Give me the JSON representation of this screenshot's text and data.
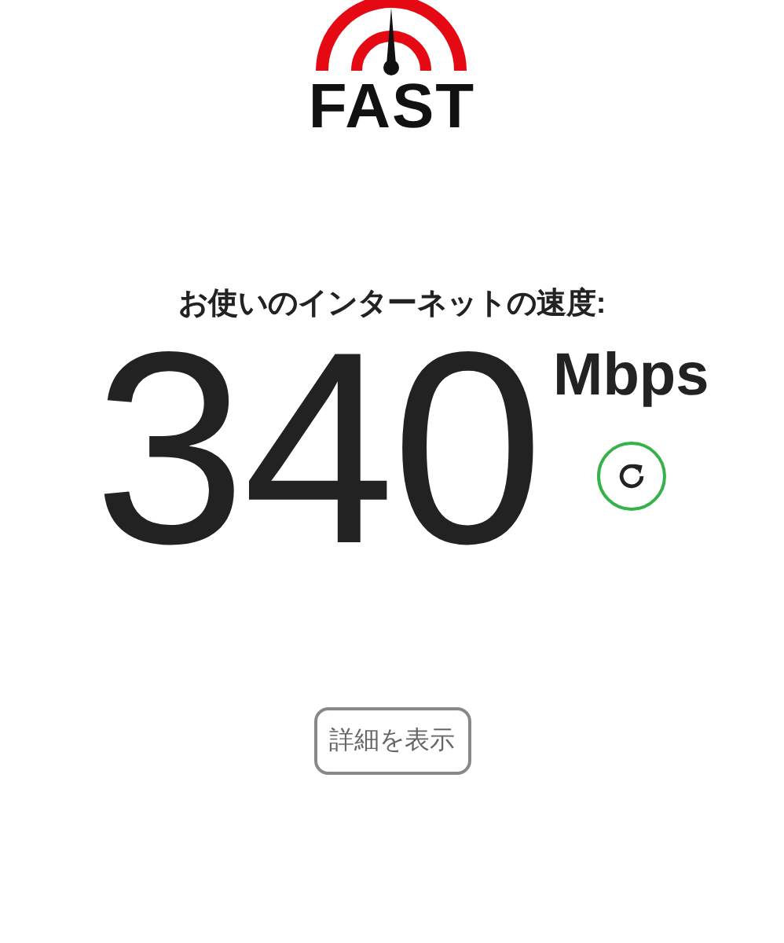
{
  "logo": {
    "text": "FAST"
  },
  "speed": {
    "heading": "お使いのインターネットの速度:",
    "value": "340",
    "unit": "Mbps"
  },
  "details_button": {
    "label": "詳細を表示"
  }
}
